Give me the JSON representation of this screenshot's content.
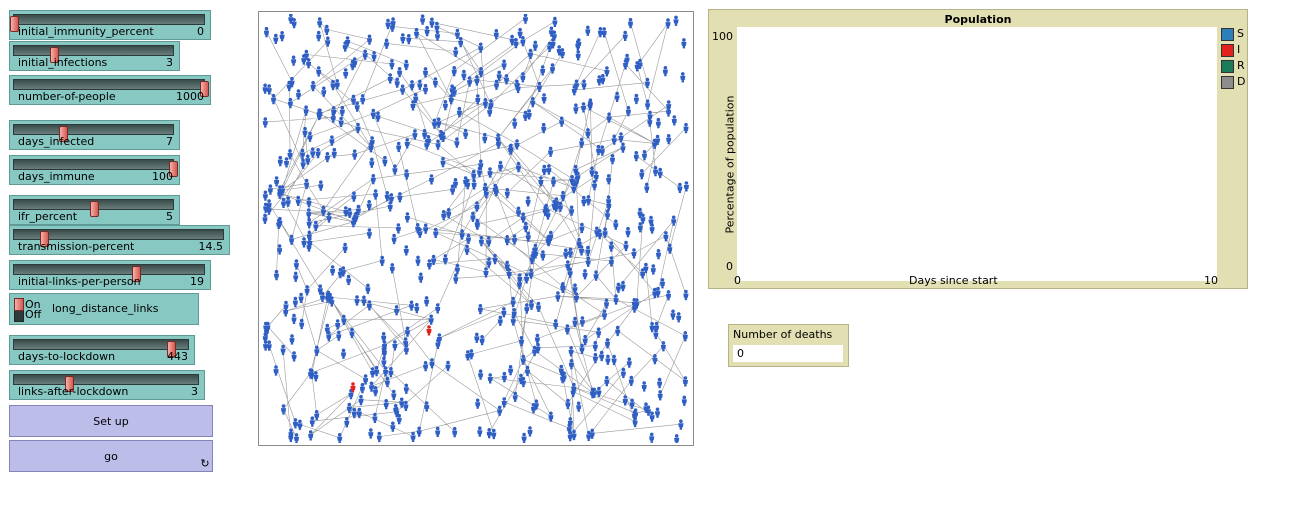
{
  "sliders": [
    {
      "label": "initial_immunity_percent",
      "value": "0",
      "fraction": 0.0
    },
    {
      "label": "initial_infections",
      "value": "3",
      "fraction": 0.25
    },
    {
      "label": "number-of-people",
      "value": "1000",
      "fraction": 1.0
    },
    {
      "label": "days_infected",
      "value": "7",
      "fraction": 0.31
    },
    {
      "label": "days_immune",
      "value": "100",
      "fraction": 1.0
    },
    {
      "label": "ifr_percent",
      "value": "5",
      "fraction": 0.5
    },
    {
      "label": "transmission-percent",
      "value": "14.5",
      "fraction": 0.145
    },
    {
      "label": "initial-links-per-person",
      "value": "19",
      "fraction": 0.64
    },
    {
      "label": "days-to-lockdown",
      "value": "443",
      "fraction": 0.9
    },
    {
      "label": "links-after-lockdown",
      "value": "3",
      "fraction": 0.3
    }
  ],
  "switch": {
    "label": "long_distance_links",
    "on_text": "On",
    "off_text": "Off",
    "state": "on"
  },
  "buttons": {
    "setup": "Set up",
    "go": "go",
    "go_forever_icon": "forever-loop-icon"
  },
  "world": {
    "link_color": "#9a9a9a",
    "person_color": "#2f5fc4",
    "infected_color": "#e2221e",
    "person_icon": "person-icon"
  },
  "plot": {
    "title": "Population",
    "xlabel": "Days since start",
    "ylabel": "Percentage of population",
    "y_max": "100",
    "y_min": "0",
    "x_min": "0",
    "x_max": "10",
    "legend": [
      {
        "name": "S",
        "color": "#2c7fb8"
      },
      {
        "name": "I",
        "color": "#e2221e"
      },
      {
        "name": "R",
        "color": "#1a7a5a"
      },
      {
        "name": "D",
        "color": "#8c8c8c"
      }
    ]
  },
  "monitor": {
    "label": "Number of deaths",
    "value": "0"
  }
}
